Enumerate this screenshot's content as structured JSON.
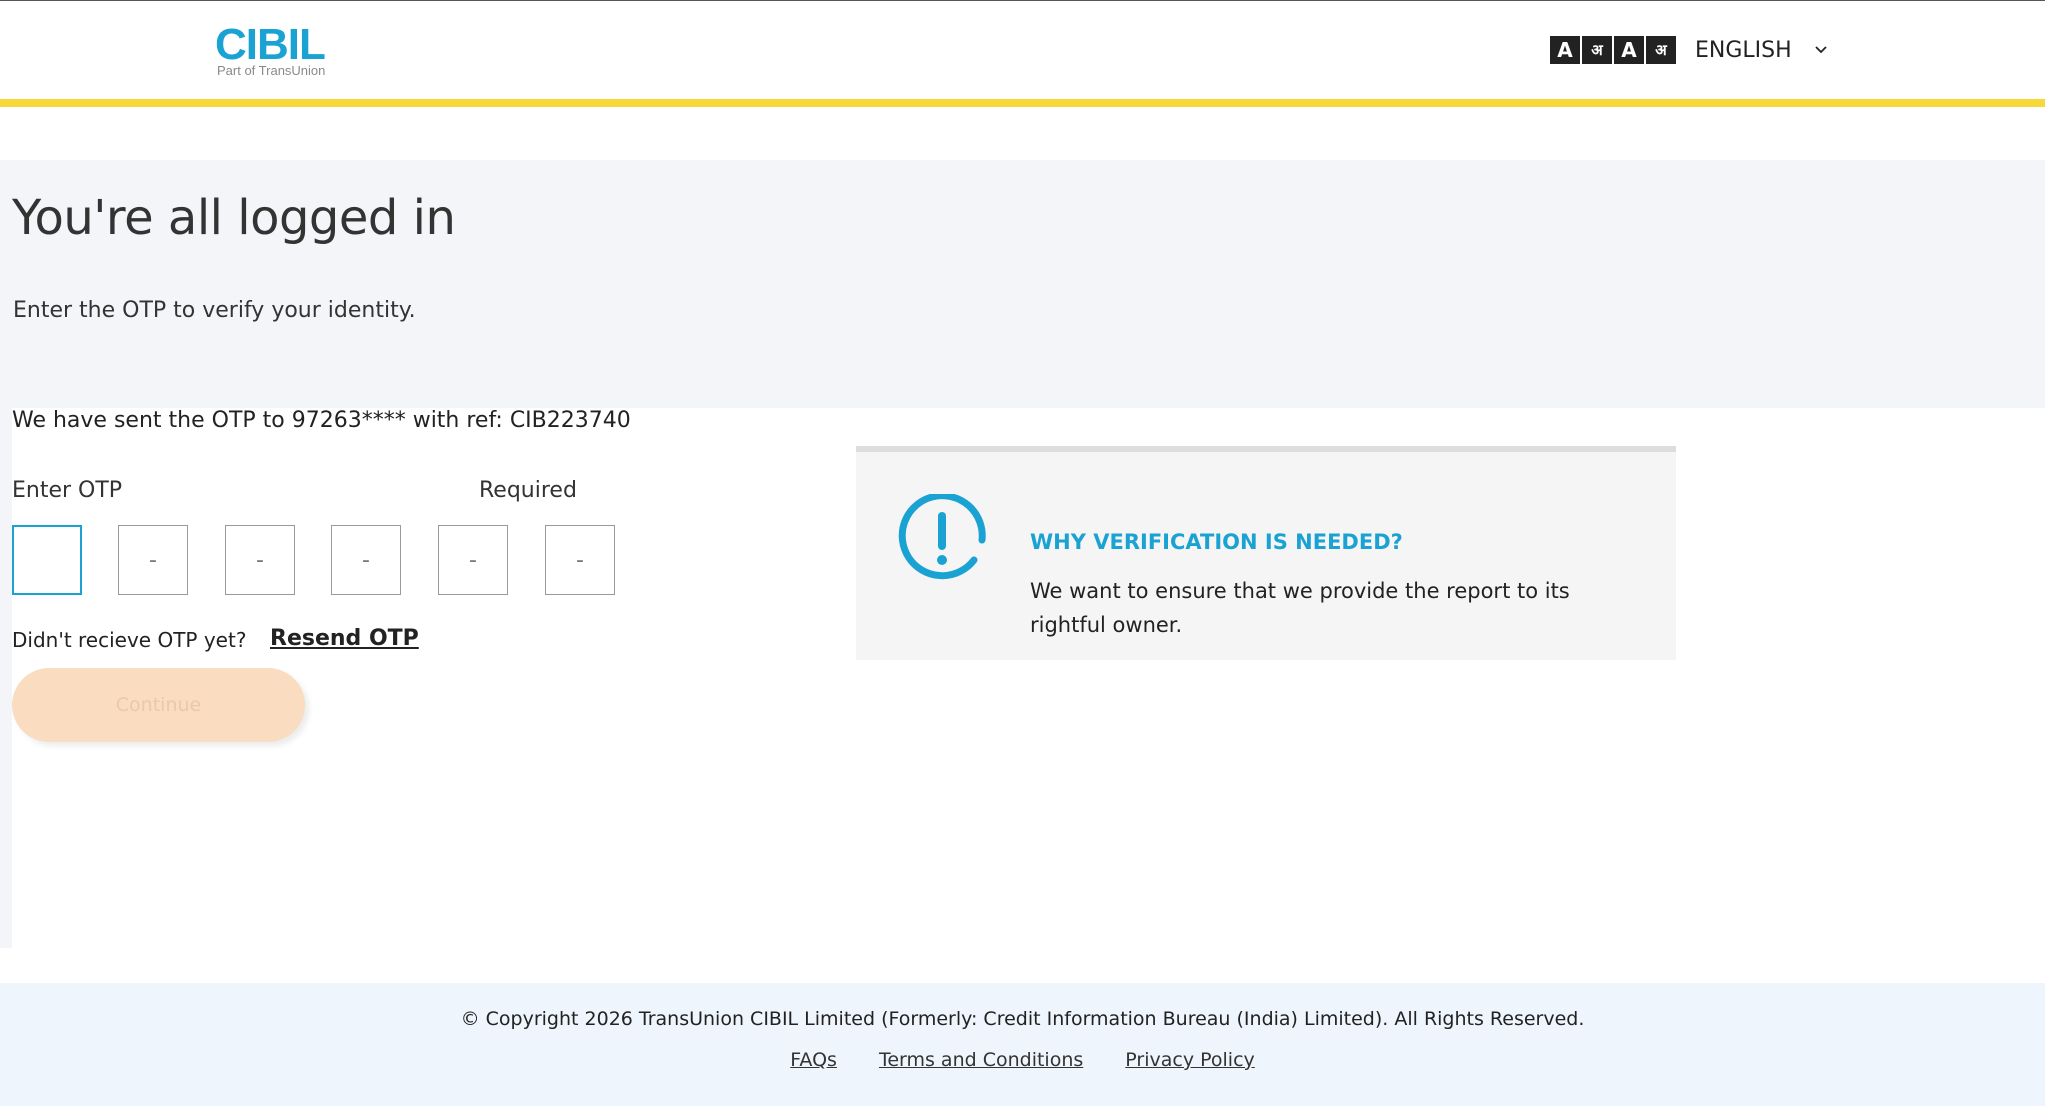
{
  "header": {
    "logo_text": "CIBIL",
    "logo_subtext": "Part of TransUnion",
    "font_size_toggle": [
      "A",
      "अ",
      "A",
      "अ"
    ],
    "language": "ENGLISH",
    "language_icon": "chevron-down-icon"
  },
  "colors": {
    "brand_blue": "#1aa3d2",
    "header_bar_yellow": "#f7d739",
    "continue_disabled_bg": "#fadcc0",
    "hero_bg": "#f4f5f8",
    "footer_bg": "#eef5fd"
  },
  "page": {
    "title": "You're all logged in",
    "subtitle": "Enter the OTP to verify your identity."
  },
  "otp": {
    "sent_message": "We have sent the OTP to 97263**** with ref: CIB223740",
    "label": "Enter OTP",
    "required_label": "Required",
    "digits": [
      {
        "value": "",
        "placeholder": ""
      },
      {
        "value": "",
        "placeholder": "-"
      },
      {
        "value": "",
        "placeholder": "-"
      },
      {
        "value": "",
        "placeholder": "-"
      },
      {
        "value": "",
        "placeholder": "-"
      },
      {
        "value": "",
        "placeholder": "-"
      }
    ],
    "resend_question": "Didn't recieve OTP yet?",
    "resend_link": "Resend OTP",
    "continue_label": "Continue"
  },
  "info_card": {
    "icon": "alert-circle-icon",
    "title": "WHY VERIFICATION IS NEEDED?",
    "text": "We want to ensure that we provide the report to its rightful owner."
  },
  "footer": {
    "copyright": "© Copyright 2026 TransUnion CIBIL Limited (Formerly: Credit Information Bureau (India) Limited). All Rights Reserved.",
    "links": [
      "FAQs",
      "Terms and Conditions",
      "Privacy Policy"
    ]
  }
}
